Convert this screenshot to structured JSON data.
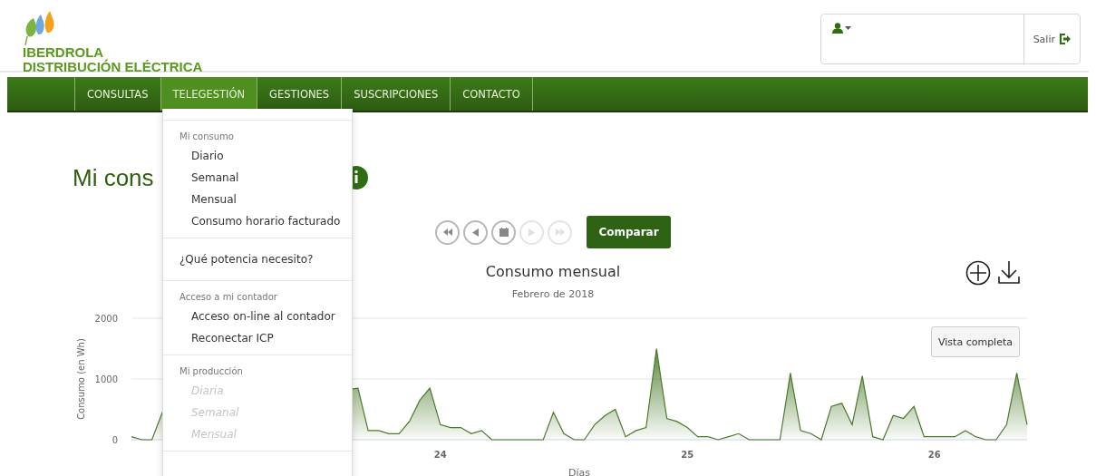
{
  "logo": {
    "lines": [
      "IBERDROLA",
      "DISTRIBUCIÓN ELÉCTRICA"
    ]
  },
  "user_box": {
    "logout": "Salir"
  },
  "nav": [
    {
      "label": "CONSULTAS",
      "selected": false
    },
    {
      "label": "TELEGESTIÓN",
      "selected": true
    },
    {
      "label": "GESTIONES",
      "selected": false
    },
    {
      "label": "SUSCRIPCIONES",
      "selected": false
    },
    {
      "label": "CONTACTO",
      "selected": false
    }
  ],
  "dropdown": {
    "sections": [
      {
        "header": "Mi consumo",
        "items": [
          {
            "label": "Diario",
            "disabled": false
          },
          {
            "label": "Semanal",
            "disabled": false
          },
          {
            "label": "Mensual",
            "disabled": false
          },
          {
            "label": "Consumo horario facturado",
            "disabled": false
          }
        ]
      },
      {
        "items": [
          {
            "label": "¿Qué potencia necesito?",
            "disabled": false
          }
        ]
      },
      {
        "header": "Acceso a mi contador",
        "items": [
          {
            "label": "Acceso on-line al contador",
            "disabled": false
          },
          {
            "label": "Reconectar ICP",
            "disabled": false
          }
        ]
      },
      {
        "header": "Mi producción",
        "items": [
          {
            "label": "Diaria",
            "disabled": true
          },
          {
            "label": "Semanal",
            "disabled": true
          },
          {
            "label": "Mensual",
            "disabled": true
          }
        ]
      }
    ]
  },
  "page_title": "Mi cons",
  "player": [
    {
      "kind": "first",
      "disabled": false
    },
    {
      "kind": "prev",
      "disabled": false
    },
    {
      "kind": "calendar",
      "disabled": false
    },
    {
      "kind": "next",
      "disabled": true
    },
    {
      "kind": "last",
      "disabled": true
    }
  ],
  "compare_button": "Comparar",
  "chart": {
    "full_view_button": "Vista completa",
    "chart_data": {
      "type": "area",
      "title": "Consumo mensual",
      "subtitle": "Febrero de 2018",
      "xlabel": "Días",
      "ylabel": "Consumo (en Wh)",
      "x": [
        22.75,
        22.792,
        22.833,
        22.875,
        23.667,
        23.708,
        23.75,
        23.792,
        23.833,
        23.875,
        23.917,
        23.958,
        24,
        24.042,
        24.083,
        24.125,
        24.167,
        24.208,
        24.25,
        24.292,
        24.333,
        24.375,
        24.417,
        24.458,
        24.5,
        24.542,
        24.583,
        24.625,
        24.667,
        24.708,
        24.75,
        24.792,
        24.833,
        24.875,
        24.917,
        24.958,
        25,
        25.042,
        25.083,
        25.125,
        25.167,
        25.208,
        25.25,
        25.292,
        25.333,
        25.375,
        25.417,
        25.458,
        25.5,
        25.542,
        25.583,
        25.625,
        25.667,
        25.708,
        25.75,
        25.792,
        25.833,
        25.875,
        25.917,
        25.958,
        26,
        26.042,
        26.083,
        26.125,
        26.167,
        26.208,
        26.25,
        26.292,
        26.333,
        26.375
      ],
      "series": [
        {
          "color": "#4a7a2a",
          "values": [
            50,
            0,
            0,
            450,
            850,
            150,
            150,
            100,
            100,
            300,
            650,
            850,
            250,
            200,
            200,
            100,
            150,
            0,
            0,
            0,
            0,
            0,
            0,
            450,
            100,
            0,
            0,
            250,
            400,
            500,
            50,
            150,
            200,
            1500,
            350,
            300,
            200,
            50,
            50,
            0,
            50,
            100,
            0,
            0,
            0,
            0,
            1100,
            150,
            100,
            0,
            550,
            600,
            250,
            1050,
            50,
            0,
            400,
            350,
            550,
            50,
            50,
            50,
            50,
            150,
            50,
            0,
            0,
            250,
            1100,
            250
          ]
        }
      ],
      "xlim": [
        22.75,
        26.375
      ],
      "ylim": [
        0,
        2000
      ],
      "xticks": [
        {
          "value": 24,
          "label": "24"
        },
        {
          "value": 25,
          "label": "25"
        },
        {
          "value": 26,
          "label": "26"
        }
      ],
      "yticks": [
        {
          "value": 0,
          "label": "0"
        },
        {
          "value": 1000,
          "label": "1000"
        },
        {
          "value": 2000,
          "label": "2000"
        }
      ]
    }
  }
}
